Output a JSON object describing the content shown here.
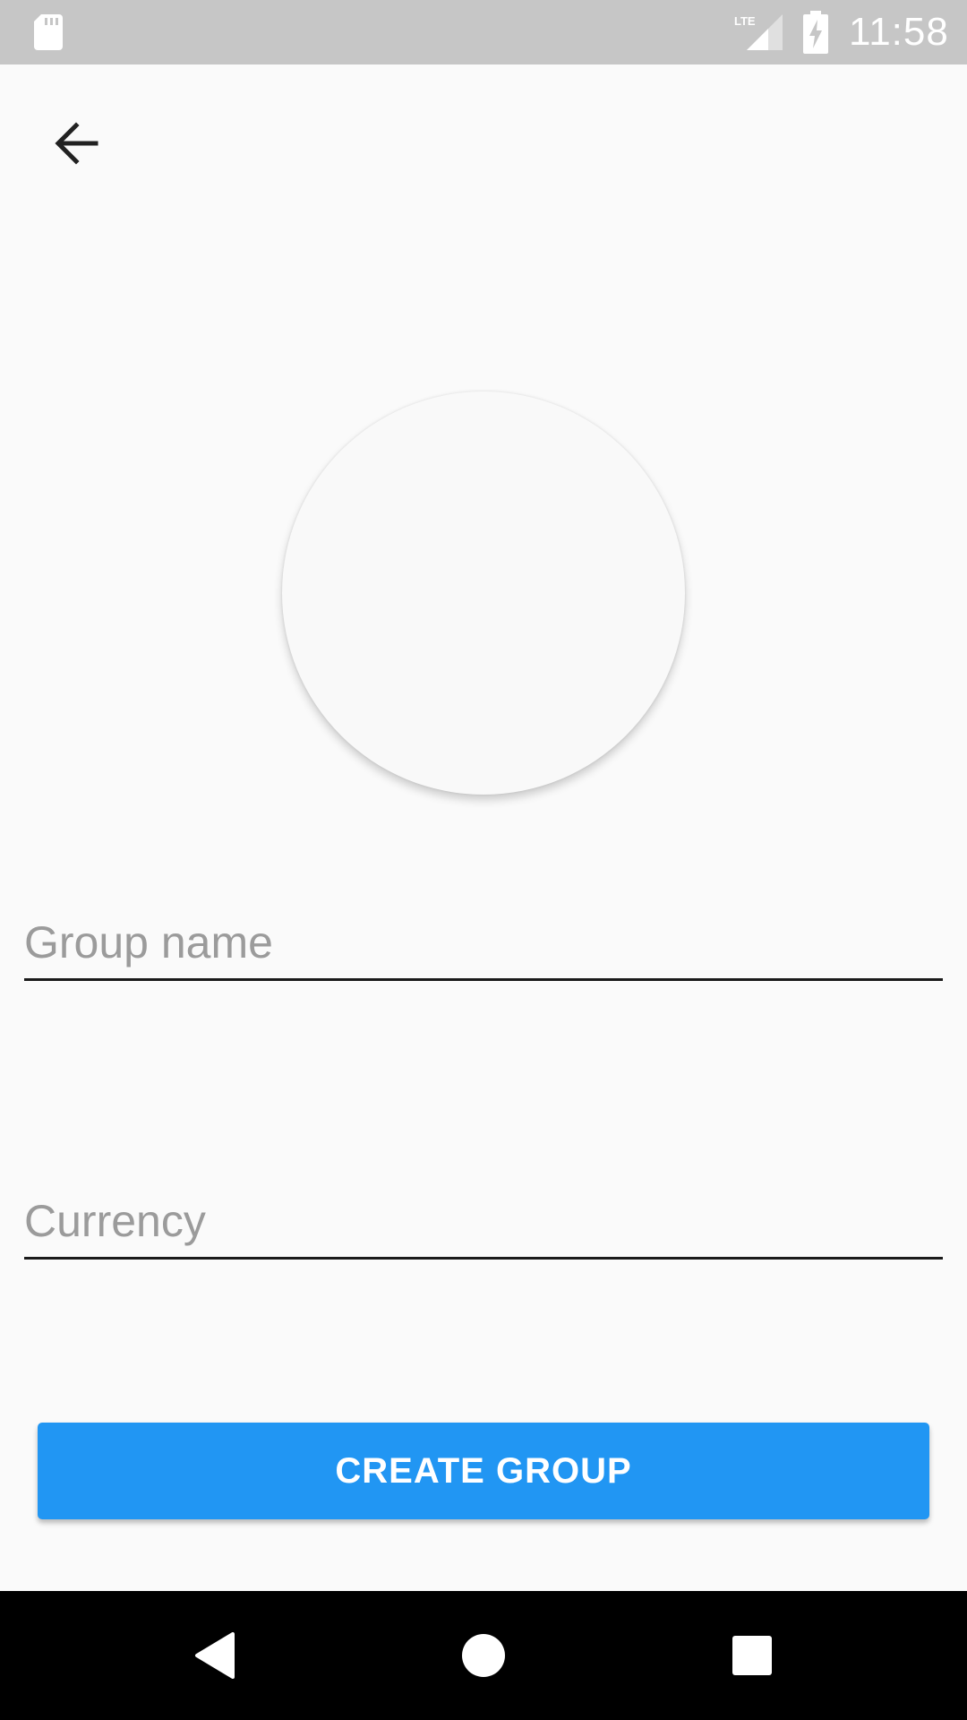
{
  "status_bar": {
    "time": "11:58",
    "network_label": "LTE",
    "icons": [
      "sd-card-icon",
      "lte-signal-icon",
      "battery-charging-icon"
    ]
  },
  "toolbar": {
    "back_icon": "arrow-back-icon"
  },
  "form": {
    "group_name": {
      "value": "",
      "placeholder": "Group name"
    },
    "currency": {
      "value": "",
      "placeholder": "Currency"
    },
    "create_label": "CREATE GROUP"
  },
  "nav_bar": {
    "icons": [
      "nav-back-icon",
      "nav-home-icon",
      "nav-recents-icon"
    ]
  },
  "colors": {
    "accent": "#2196f3",
    "background": "#fafafa",
    "status_bar": "#c6c6c6",
    "nav_bar": "#000000"
  }
}
